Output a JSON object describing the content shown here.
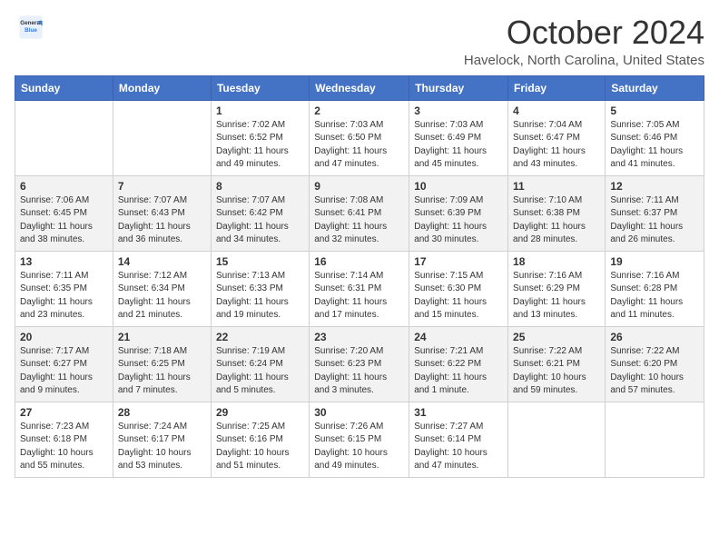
{
  "header": {
    "logo_line1": "General",
    "logo_line2": "Blue",
    "month_title": "October 2024",
    "location": "Havelock, North Carolina, United States"
  },
  "weekdays": [
    "Sunday",
    "Monday",
    "Tuesday",
    "Wednesday",
    "Thursday",
    "Friday",
    "Saturday"
  ],
  "weeks": [
    [
      {
        "day": "",
        "info": ""
      },
      {
        "day": "",
        "info": ""
      },
      {
        "day": "1",
        "info": "Sunrise: 7:02 AM\nSunset: 6:52 PM\nDaylight: 11 hours and 49 minutes."
      },
      {
        "day": "2",
        "info": "Sunrise: 7:03 AM\nSunset: 6:50 PM\nDaylight: 11 hours and 47 minutes."
      },
      {
        "day": "3",
        "info": "Sunrise: 7:03 AM\nSunset: 6:49 PM\nDaylight: 11 hours and 45 minutes."
      },
      {
        "day": "4",
        "info": "Sunrise: 7:04 AM\nSunset: 6:47 PM\nDaylight: 11 hours and 43 minutes."
      },
      {
        "day": "5",
        "info": "Sunrise: 7:05 AM\nSunset: 6:46 PM\nDaylight: 11 hours and 41 minutes."
      }
    ],
    [
      {
        "day": "6",
        "info": "Sunrise: 7:06 AM\nSunset: 6:45 PM\nDaylight: 11 hours and 38 minutes."
      },
      {
        "day": "7",
        "info": "Sunrise: 7:07 AM\nSunset: 6:43 PM\nDaylight: 11 hours and 36 minutes."
      },
      {
        "day": "8",
        "info": "Sunrise: 7:07 AM\nSunset: 6:42 PM\nDaylight: 11 hours and 34 minutes."
      },
      {
        "day": "9",
        "info": "Sunrise: 7:08 AM\nSunset: 6:41 PM\nDaylight: 11 hours and 32 minutes."
      },
      {
        "day": "10",
        "info": "Sunrise: 7:09 AM\nSunset: 6:39 PM\nDaylight: 11 hours and 30 minutes."
      },
      {
        "day": "11",
        "info": "Sunrise: 7:10 AM\nSunset: 6:38 PM\nDaylight: 11 hours and 28 minutes."
      },
      {
        "day": "12",
        "info": "Sunrise: 7:11 AM\nSunset: 6:37 PM\nDaylight: 11 hours and 26 minutes."
      }
    ],
    [
      {
        "day": "13",
        "info": "Sunrise: 7:11 AM\nSunset: 6:35 PM\nDaylight: 11 hours and 23 minutes."
      },
      {
        "day": "14",
        "info": "Sunrise: 7:12 AM\nSunset: 6:34 PM\nDaylight: 11 hours and 21 minutes."
      },
      {
        "day": "15",
        "info": "Sunrise: 7:13 AM\nSunset: 6:33 PM\nDaylight: 11 hours and 19 minutes."
      },
      {
        "day": "16",
        "info": "Sunrise: 7:14 AM\nSunset: 6:31 PM\nDaylight: 11 hours and 17 minutes."
      },
      {
        "day": "17",
        "info": "Sunrise: 7:15 AM\nSunset: 6:30 PM\nDaylight: 11 hours and 15 minutes."
      },
      {
        "day": "18",
        "info": "Sunrise: 7:16 AM\nSunset: 6:29 PM\nDaylight: 11 hours and 13 minutes."
      },
      {
        "day": "19",
        "info": "Sunrise: 7:16 AM\nSunset: 6:28 PM\nDaylight: 11 hours and 11 minutes."
      }
    ],
    [
      {
        "day": "20",
        "info": "Sunrise: 7:17 AM\nSunset: 6:27 PM\nDaylight: 11 hours and 9 minutes."
      },
      {
        "day": "21",
        "info": "Sunrise: 7:18 AM\nSunset: 6:25 PM\nDaylight: 11 hours and 7 minutes."
      },
      {
        "day": "22",
        "info": "Sunrise: 7:19 AM\nSunset: 6:24 PM\nDaylight: 11 hours and 5 minutes."
      },
      {
        "day": "23",
        "info": "Sunrise: 7:20 AM\nSunset: 6:23 PM\nDaylight: 11 hours and 3 minutes."
      },
      {
        "day": "24",
        "info": "Sunrise: 7:21 AM\nSunset: 6:22 PM\nDaylight: 11 hours and 1 minute."
      },
      {
        "day": "25",
        "info": "Sunrise: 7:22 AM\nSunset: 6:21 PM\nDaylight: 10 hours and 59 minutes."
      },
      {
        "day": "26",
        "info": "Sunrise: 7:22 AM\nSunset: 6:20 PM\nDaylight: 10 hours and 57 minutes."
      }
    ],
    [
      {
        "day": "27",
        "info": "Sunrise: 7:23 AM\nSunset: 6:18 PM\nDaylight: 10 hours and 55 minutes."
      },
      {
        "day": "28",
        "info": "Sunrise: 7:24 AM\nSunset: 6:17 PM\nDaylight: 10 hours and 53 minutes."
      },
      {
        "day": "29",
        "info": "Sunrise: 7:25 AM\nSunset: 6:16 PM\nDaylight: 10 hours and 51 minutes."
      },
      {
        "day": "30",
        "info": "Sunrise: 7:26 AM\nSunset: 6:15 PM\nDaylight: 10 hours and 49 minutes."
      },
      {
        "day": "31",
        "info": "Sunrise: 7:27 AM\nSunset: 6:14 PM\nDaylight: 10 hours and 47 minutes."
      },
      {
        "day": "",
        "info": ""
      },
      {
        "day": "",
        "info": ""
      }
    ]
  ]
}
